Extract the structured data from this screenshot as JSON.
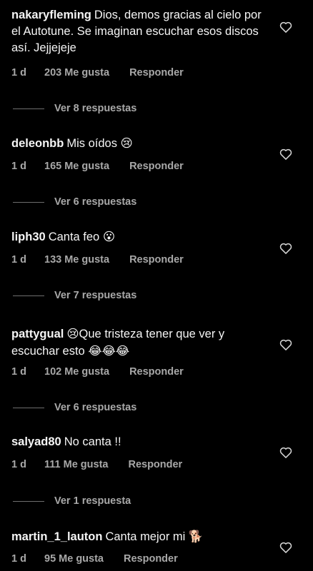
{
  "comments": [
    {
      "username": "nakaryfleming",
      "text": "Dios, demos gracias al cielo por el Autotune. Se imaginan escuchar esos discos así. Jejjejeje",
      "time": "1 d",
      "likes": "203 Me gusta",
      "reply": "Responder",
      "view_replies": "Ver 8 respuestas"
    },
    {
      "username": "deleonbb",
      "text": "Mis oídos",
      "emoji_after": "😢",
      "time": "1 d",
      "likes": "165 Me gusta",
      "reply": "Responder",
      "view_replies": "Ver 6 respuestas"
    },
    {
      "username": "liph30",
      "text": "Canta feo",
      "emoji_after": "😮",
      "time": "1 d",
      "likes": "133 Me gusta",
      "reply": "Responder",
      "view_replies": "Ver 7 respuestas"
    },
    {
      "username": "pattygual",
      "emoji_before": "😢",
      "text": "Que tristeza tener que ver y escuchar esto",
      "emoji_after": "😂😂😂",
      "time": "1 d",
      "likes": "102 Me gusta",
      "reply": "Responder",
      "view_replies": "Ver 6 respuestas"
    },
    {
      "username": "salyad80",
      "text": "No canta !!",
      "time": "1 d",
      "likes": "111 Me gusta",
      "reply": "Responder",
      "view_replies": "Ver 1 respuesta"
    },
    {
      "username": "martin_1_lauton",
      "text": "Canta mejor mi",
      "emoji_after": "🐕",
      "time": "1 d",
      "likes": "95 Me gusta",
      "reply": "Responder"
    }
  ],
  "icons": {
    "like": "heart-outline-icon"
  },
  "colors": {
    "background": "#000000",
    "text": "#f5f5f5",
    "secondary": "#a8a8a8"
  }
}
